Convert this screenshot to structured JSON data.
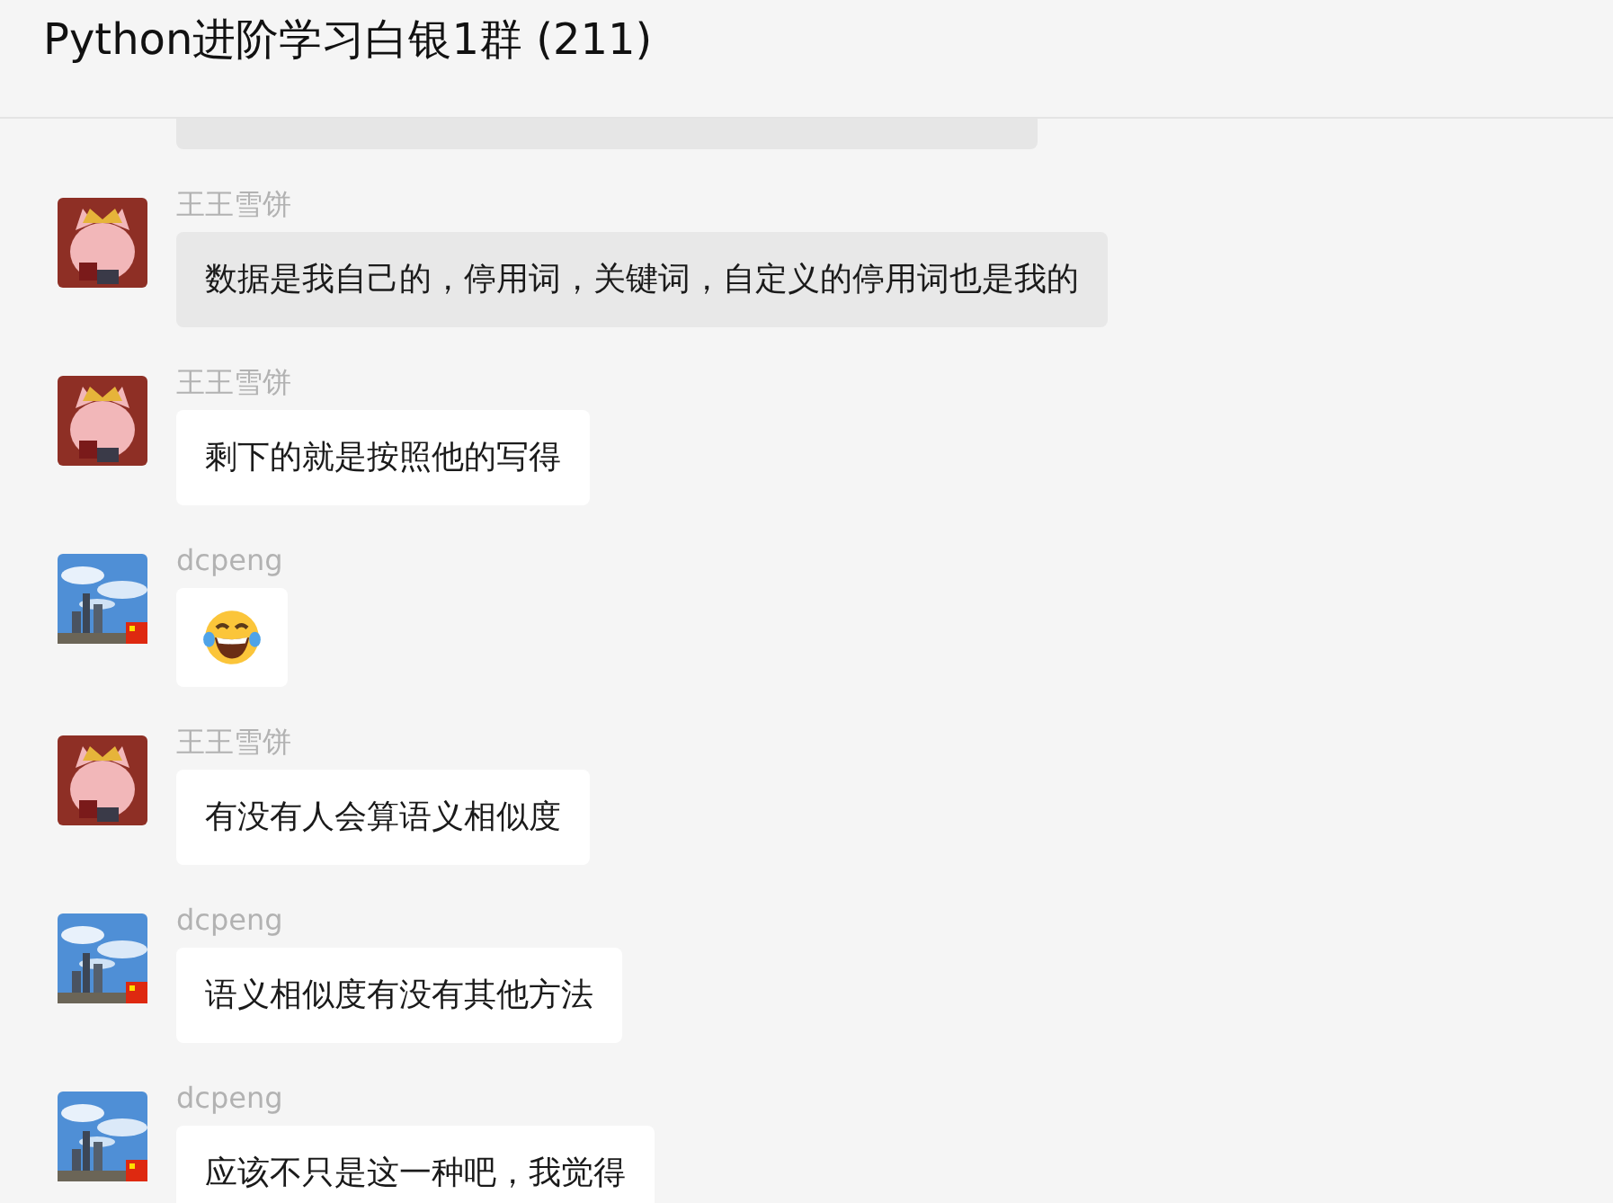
{
  "window": {
    "title": "Python进阶学习白银1群 (211)"
  },
  "messages": [
    {
      "sender": "王王雪饼",
      "avatar": {
        "kind": "illustration"
      },
      "kind": "text",
      "text": "数据是我自己的，停用词，关键词，自定义的停用词也是我的",
      "highlighted": true
    },
    {
      "sender": "王王雪饼",
      "avatar": {
        "kind": "illustration"
      },
      "kind": "text",
      "text": "剩下的就是按照他的写得",
      "highlighted": false
    },
    {
      "sender": "dcpeng",
      "kind": "emoji",
      "highlighted": false
    },
    {
      "sender": "王王雪饼",
      "avatar": {
        "kind": "illustration"
      },
      "kind": "text",
      "text": "有没有人会算语义相似度",
      "highlighted": false
    },
    {
      "sender": "dcpeng",
      "kind": "text",
      "text": "语义相似度有没有其他方法",
      "highlighted": false
    },
    {
      "sender": "dcpeng",
      "kind": "text",
      "text": "应该不只是这一种吧，我觉得",
      "highlighted": false
    }
  ]
}
